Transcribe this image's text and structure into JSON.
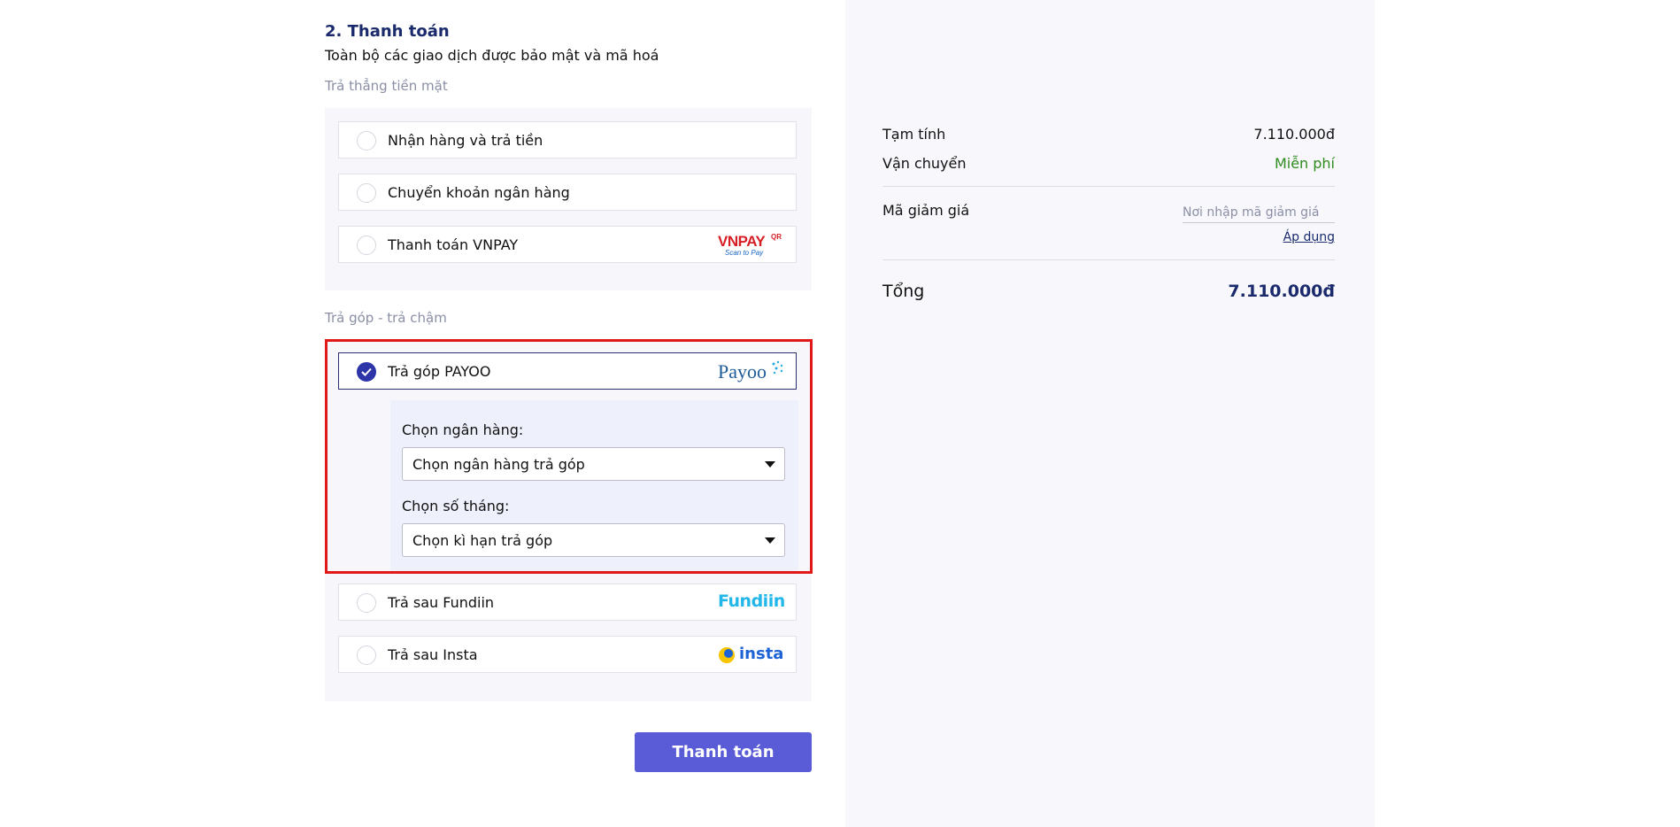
{
  "payment": {
    "title": "2. Thanh toán",
    "subtitle": "Toàn bộ các giao dịch được bảo mật và mã hoá",
    "cash_group_label": "Trả thẳng tiền mặt",
    "cash_options": [
      {
        "label": "Nhận hàng và trả tiền"
      },
      {
        "label": "Chuyển khoản ngân hàng"
      },
      {
        "label": "Thanh toán VNPAY"
      }
    ],
    "vnpay_logo": {
      "main": "VNPAY",
      "sup": "QR",
      "tagline": "Scan to Pay"
    },
    "installment_group_label": "Trả góp - trả chậm",
    "installment_options": [
      {
        "label": "Trả góp PAYOO",
        "selected": true
      },
      {
        "label": "Trả sau Fundiin"
      },
      {
        "label": "Trả sau Insta"
      }
    ],
    "payoo_logo": "Payoo",
    "fundiin_logo": "Fundiin",
    "insta_logo": "insta",
    "bank_label": "Chọn ngân hàng:",
    "bank_select": "Chọn ngân hàng trả góp",
    "months_label": "Chọn số tháng:",
    "months_select": "Chọn kì hạn trả góp",
    "pay_button": "Thanh toán"
  },
  "summary": {
    "subtotal_label": "Tạm tính",
    "subtotal_value": "7.110.000đ",
    "shipping_label": "Vận chuyển",
    "shipping_value": "Miễn phí",
    "coupon_label": "Mã giảm giá",
    "coupon_placeholder": "Nơi nhập mã giảm giá",
    "apply_label": "Áp dụng",
    "total_label": "Tổng",
    "total_value": "7.110.000đ"
  },
  "colors": {
    "accent": "#5a5bd6",
    "title": "#1a2a6c",
    "free_shipping": "#2e8b1e",
    "highlight": "#e01818"
  }
}
